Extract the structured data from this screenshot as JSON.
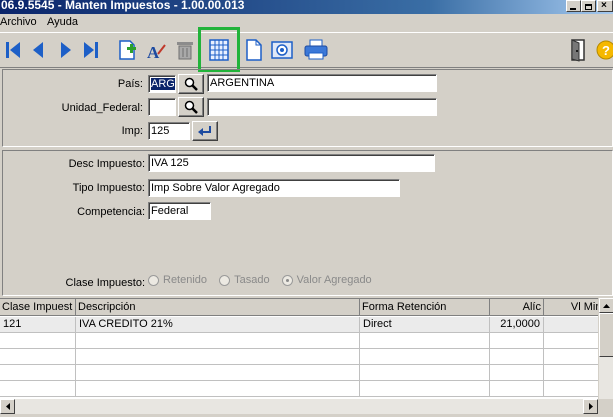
{
  "window": {
    "title": "06.9.5545 - Manten Impuestos - 1.00.00.013"
  },
  "menu": [
    {
      "label": "Archivo"
    },
    {
      "label": "Ayuda"
    }
  ],
  "form": {
    "pais_label": "País:",
    "pais_code": "ARG",
    "pais_name": "ARGENTINA",
    "unidad_federal_label": "Unidad_Federal:",
    "unidad_federal_code": "",
    "unidad_federal_name": "",
    "imp_label": "Imp:",
    "imp_value": "125",
    "desc_impuesto_label": "Desc Impuesto:",
    "desc_impuesto_value": "IVA 125",
    "tipo_impuesto_label": "Tipo Impuesto:",
    "tipo_impuesto_value": "Imp Sobre Valor Agregado",
    "competencia_label": "Competencia:",
    "competencia_value": "Federal",
    "clase_impuesto_label": "Clase Impuesto:",
    "clase_options": [
      {
        "label": "Retenido",
        "selected": false
      },
      {
        "label": "Tasado",
        "selected": false
      },
      {
        "label": "Valor Agregado",
        "selected": true
      }
    ]
  },
  "grid": {
    "columns": [
      "Clase Impuest",
      "Descripción",
      "Forma Retención",
      "Alíc",
      "Vl Mir"
    ],
    "rows": [
      [
        "121",
        "IVA CREDITO 21%",
        "Direct",
        "21,0000",
        ""
      ]
    ]
  },
  "colors": {
    "highlight": "#22b33a",
    "title_bar": "#0a246a",
    "toolbar_blue": "#1d5fc7"
  },
  "icons": {
    "toolbar": [
      "first-record-icon",
      "previous-record-icon",
      "next-record-icon",
      "last-record-icon",
      "new-record-icon",
      "edit-record-icon",
      "delete-icon",
      "grid-view-icon",
      "blank-page-icon",
      "preview-icon",
      "print-icon",
      "exit-door-icon",
      "help-icon"
    ]
  }
}
